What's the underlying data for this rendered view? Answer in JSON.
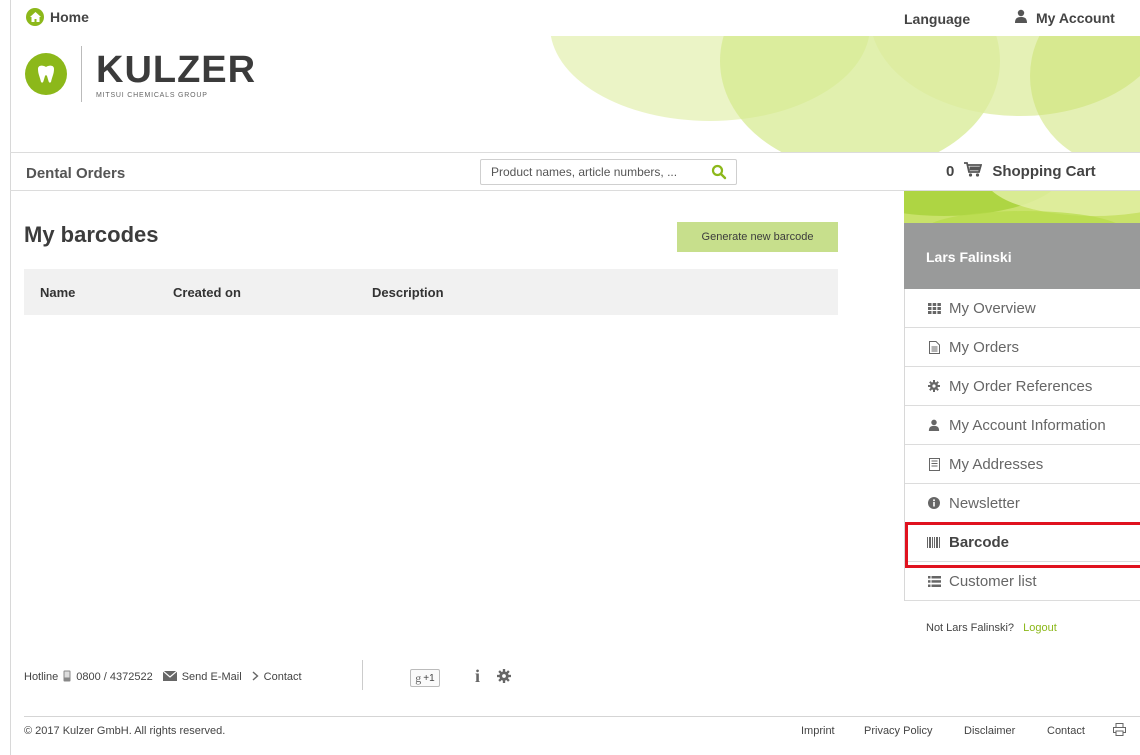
{
  "topbar": {
    "home_label": "Home",
    "language_label": "Language",
    "account_label": "My Account"
  },
  "brand": {
    "name": "KULZER",
    "subtitle": "MITSUI CHEMICALS GROUP"
  },
  "navbar": {
    "section_label": "Dental Orders",
    "search_placeholder": "Product names, article numbers, ...",
    "cart_count": "0",
    "cart_label": "Shopping Cart"
  },
  "main": {
    "title": "My barcodes",
    "generate_button": "Generate new barcode",
    "columns": [
      "Name",
      "Created on",
      "Description"
    ]
  },
  "sidebar": {
    "user_name": "Lars Falinski",
    "items": [
      {
        "label": "My Overview",
        "icon": "grid-icon"
      },
      {
        "label": "My Orders",
        "icon": "document-icon"
      },
      {
        "label": "My Order References",
        "icon": "gear-icon"
      },
      {
        "label": "My Account Information",
        "icon": "user-icon"
      },
      {
        "label": "My Addresses",
        "icon": "address-book-icon"
      },
      {
        "label": "Newsletter",
        "icon": "info-icon"
      },
      {
        "label": "Barcode",
        "icon": "barcode-icon",
        "active": true
      },
      {
        "label": "Customer list",
        "icon": "list-icon"
      }
    ],
    "not_user_text": "Not Lars Falinski?",
    "logout_label": "Logout"
  },
  "footer": {
    "hotline_label": "Hotline",
    "phone": "0800 / 4372522",
    "email_label": "Send E-Mail",
    "contact_label": "Contact",
    "gplus_label": "+1",
    "info_label": "i",
    "copyright": "© 2017 Kulzer GmbH. All rights reserved.",
    "links": [
      "Imprint",
      "Privacy Policy",
      "Disclaimer",
      "Contact"
    ]
  },
  "colors": {
    "accent": "#8cb81a",
    "button_bg": "#c7df8c",
    "sidebar_header": "#999a9a",
    "highlight": "#e0121f"
  }
}
